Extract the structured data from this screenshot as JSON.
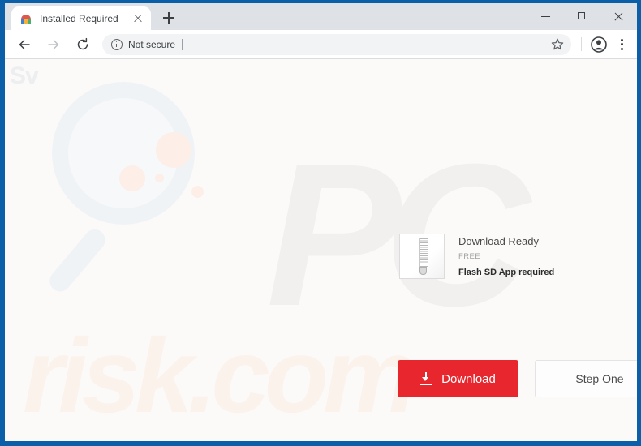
{
  "window": {
    "controls": {
      "minimize_label": "Minimize",
      "maximize_label": "Maximize",
      "close_label": "Close"
    }
  },
  "tabs": [
    {
      "title": "Installed Required",
      "favicon": "app-favicon",
      "close_label": "Close tab"
    }
  ],
  "newtab": {
    "label": "New tab"
  },
  "toolbar": {
    "back_label": "Back",
    "forward_label": "Forward",
    "reload_label": "Reload",
    "security_text": "Not secure",
    "url_value": "",
    "url_placeholder": "",
    "bookmark_label": "Bookmark this tab",
    "profile_label": "Profile",
    "menu_label": "Customize and control Google Chrome"
  },
  "watermarks": {
    "logo": "Sv",
    "big_text": "PC",
    "domain_text": "risk.com"
  },
  "download_card": {
    "file_icon": "zip-file-icon",
    "title": "Download Ready",
    "price": "FREE",
    "requirement": "Flash SD App required"
  },
  "actions": {
    "download_label": "Download",
    "download_icon": "download-arrow-icon",
    "step_label": "Step One"
  },
  "colors": {
    "window_frame": "#0b5ea8",
    "accent_red": "#e8262d",
    "tabstrip": "#dee1e6",
    "page_bg": "#fbfaf9"
  }
}
